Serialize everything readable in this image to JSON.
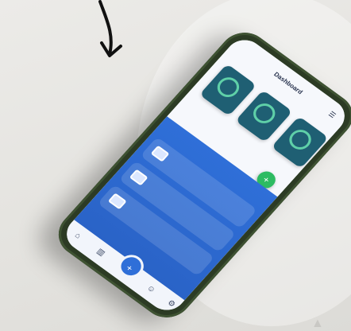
{
  "screen": {
    "title": "Dashboard",
    "subtitle": "",
    "cards": [
      {
        "value": ""
      },
      {
        "value": ""
      },
      {
        "value": ""
      }
    ],
    "summary": {
      "title": "",
      "subtitle": ""
    },
    "section_title": "",
    "list_items": [
      {
        "title": "",
        "subtitle": ""
      },
      {
        "title": "",
        "subtitle": ""
      },
      {
        "title": "",
        "subtitle": ""
      }
    ]
  },
  "icons": {
    "menu": "menu-icon",
    "fab": "add-icon",
    "nav": [
      "home-icon",
      "chart-icon",
      "add-icon",
      "users-icon",
      "settings-icon"
    ]
  },
  "colors": {
    "phone_frame": "#2c3b24",
    "primary_blue": "#2f6fd8",
    "card_teal": "#1f5f73",
    "ring_green": "#5fd0a8",
    "fab_green": "#2dbb62"
  }
}
